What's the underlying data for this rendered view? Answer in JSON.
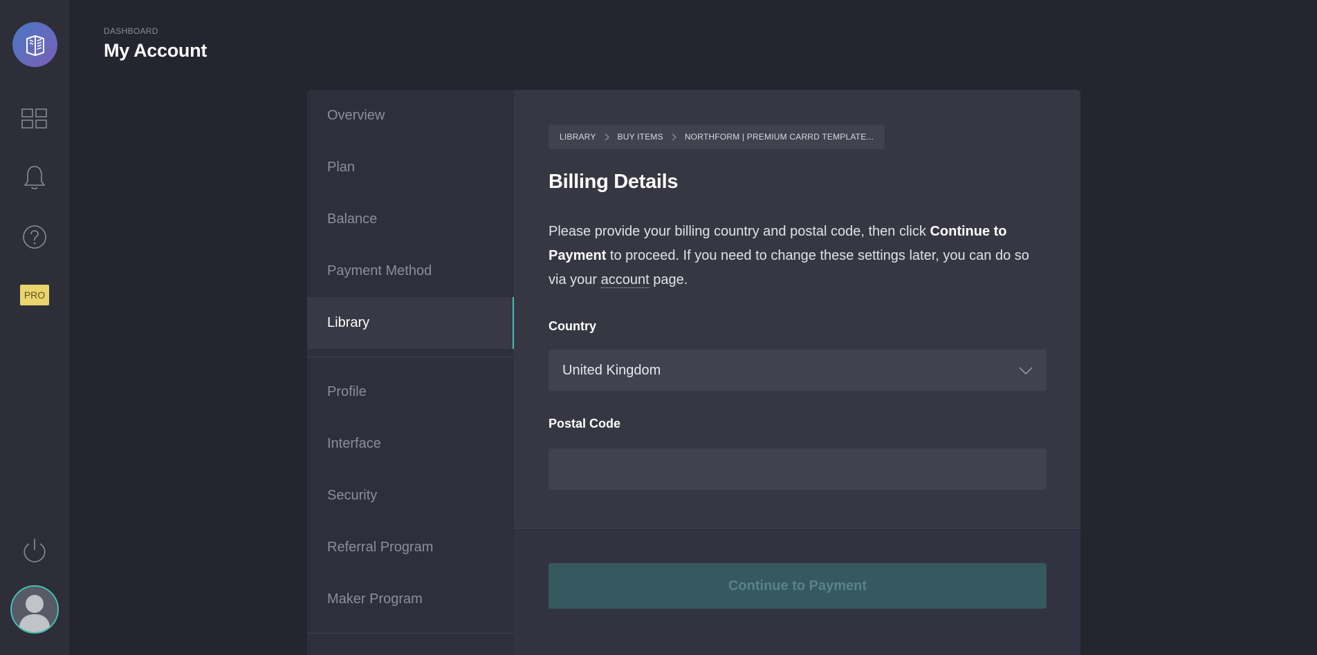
{
  "rail": {
    "logo_icon": "book-logo-icon",
    "items": [
      {
        "name": "dashboard-grid-icon"
      },
      {
        "name": "bell-icon"
      },
      {
        "name": "help-icon"
      }
    ],
    "pro_label": "PRO",
    "power_icon": "power-icon",
    "avatar_icon": "user-avatar-icon"
  },
  "header": {
    "breadcrumb": "DASHBOARD",
    "title": "My Account"
  },
  "account_nav": {
    "items": [
      {
        "label": "Overview"
      },
      {
        "label": "Plan"
      },
      {
        "label": "Balance"
      },
      {
        "label": "Payment Method"
      },
      {
        "label": "Library"
      },
      {
        "label": "Profile"
      },
      {
        "label": "Interface"
      },
      {
        "label": "Security"
      },
      {
        "label": "Referral Program"
      },
      {
        "label": "Maker Program"
      }
    ],
    "active": "Library"
  },
  "billing": {
    "breadcrumb": [
      "LIBRARY",
      "BUY ITEMS",
      "NORTHFORM | PREMIUM CARRD TEMPLATE..."
    ],
    "title": "Billing Details",
    "description": {
      "part1": "Please provide your billing country and postal code, then click ",
      "bold": "Continue to Payment",
      "part2": " to proceed. If you need to change these settings later, you can do so via your ",
      "link": "account",
      "part3": " page."
    },
    "country_label": "Country",
    "country_value": "United Kingdom",
    "postal_label": "Postal Code",
    "postal_value": "",
    "continue_label": "Continue to Payment"
  },
  "colors": {
    "accent": "#3fc2b2",
    "pro_badge": "#e9d56b",
    "button_disabled": "#36585f"
  }
}
